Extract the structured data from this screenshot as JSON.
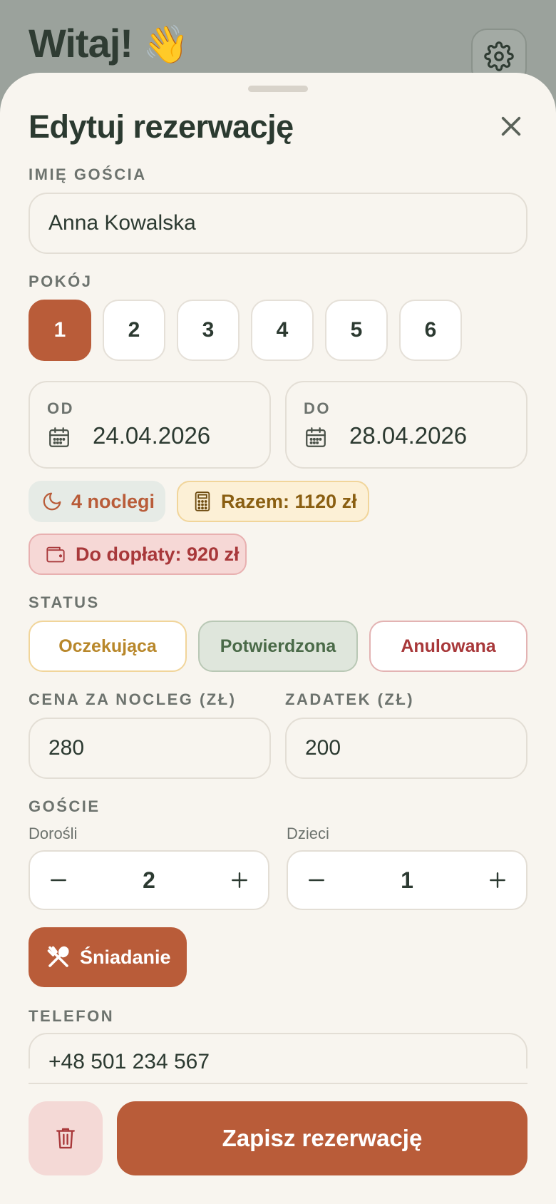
{
  "background": {
    "greeting": "Witaj!",
    "wave_emoji": "👋"
  },
  "sheet": {
    "title": "Edytuj rezerwację",
    "guest_name": {
      "label": "IMIĘ GOŚCIA",
      "value": "Anna Kowalska"
    },
    "room": {
      "label": "POKÓJ",
      "options": [
        "1",
        "2",
        "3",
        "4",
        "5",
        "6"
      ],
      "selected": "1"
    },
    "date_from": {
      "label": "OD",
      "value": "24.04.2026"
    },
    "date_to": {
      "label": "DO",
      "value": "28.04.2026"
    },
    "nights_chip": "4 noclegi",
    "total_chip": "Razem: 1120 zł",
    "due_chip": "Do dopłaty: 920 zł",
    "status": {
      "label": "STATUS",
      "options": [
        "Oczekująca",
        "Potwierdzona",
        "Anulowana"
      ],
      "selected": "Potwierdzona"
    },
    "price": {
      "label": "CENA ZA NOCLEG (ZŁ)",
      "value": "280"
    },
    "deposit": {
      "label": "ZADATEK (ZŁ)",
      "value": "200"
    },
    "guests": {
      "label": "GOŚCIE",
      "adults_label": "Dorośli",
      "adults": "2",
      "children_label": "Dzieci",
      "children": "1"
    },
    "breakfast_label": "Śniadanie",
    "phone": {
      "label": "TELEFON",
      "value": "+48 501 234 567"
    },
    "save_label": "Zapisz rezerwację"
  },
  "colors": {
    "accent": "#b95c39",
    "text": "#2c3a31",
    "pending": "#b8872a",
    "confirmed": "#4a6a48",
    "cancelled": "#a8383a"
  }
}
